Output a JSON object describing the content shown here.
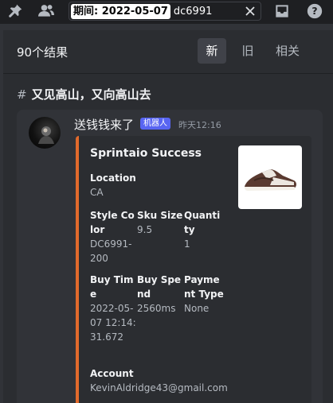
{
  "toolbar": {
    "icons": [
      "pin-icon",
      "members-icon",
      "inbox-icon",
      "help-icon"
    ]
  },
  "search": {
    "filter_chip": "期间: 2022-05-07",
    "query": "dc6991"
  },
  "results": {
    "count_label": "90个结果",
    "tabs": [
      {
        "label": "新",
        "active": true
      },
      {
        "label": "旧",
        "active": false
      },
      {
        "label": "相关",
        "active": false
      }
    ]
  },
  "channel": {
    "name": "又见高山，又向高山去"
  },
  "message": {
    "author": "送钱钱来了",
    "badge": "机器人",
    "timestamp": "昨天12:16",
    "embed": {
      "accent_color": "#e26a2c",
      "title": "Sprintaio Success",
      "fields": {
        "location": {
          "name": "Location",
          "value": "CA"
        },
        "style_color": {
          "name": "Style Color",
          "value": "DC6991-200"
        },
        "sku_size": {
          "name": "Sku Size",
          "value": "9.5"
        },
        "quantity": {
          "name": "Quantity",
          "value": "1"
        },
        "buy_time": {
          "name": "Buy Time",
          "value": "2022-05-07 12:14:31.672"
        },
        "buy_spend": {
          "name": "Buy Spend",
          "value": "2560ms"
        },
        "payment_type": {
          "name": "Payment Type",
          "value": "None"
        },
        "account": {
          "name": "Account",
          "value": "KevinAldridge43@gmail.com"
        }
      }
    }
  }
}
